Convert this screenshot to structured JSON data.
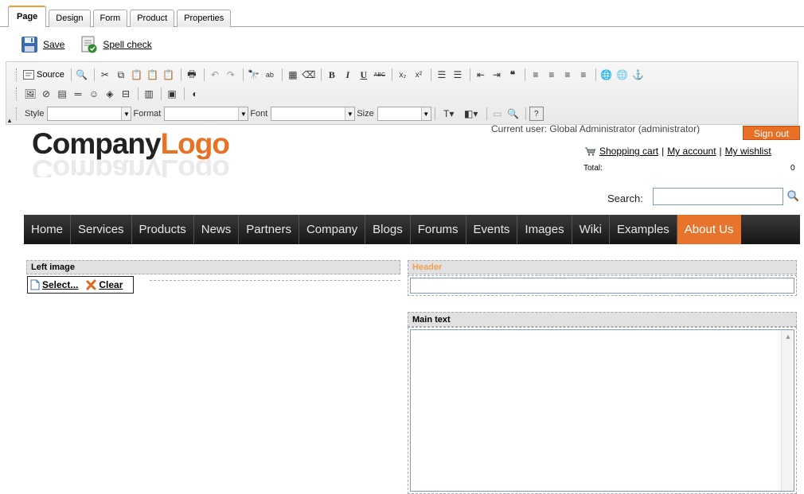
{
  "tabs": [
    "Page",
    "Design",
    "Form",
    "Product",
    "Properties"
  ],
  "actions": {
    "save": "Save",
    "spell": "Spell check"
  },
  "toolbar": {
    "source": "Source",
    "style_label": "Style",
    "format_label": "Format",
    "font_label": "Font",
    "size_label": "Size"
  },
  "logo": {
    "part1": "Company",
    "part2": "Logo"
  },
  "user": {
    "current": "Current user:  Global Administrator (administrator)",
    "signout": "Sign out"
  },
  "links": {
    "cart": "Shopping cart",
    "account": "My account",
    "wishlist": "My wishlist"
  },
  "total": {
    "label": "Total:",
    "value": "0"
  },
  "search": {
    "label": "Search:",
    "value": ""
  },
  "menu": [
    "Home",
    "Services",
    "Products",
    "News",
    "Partners",
    "Company",
    "Blogs",
    "Forums",
    "Events",
    "Images",
    "Wiki",
    "Examples",
    "About Us"
  ],
  "menu_active": "About Us",
  "editor": {
    "left_image": "Left image",
    "select": "Select...",
    "clear": "Clear",
    "header": "Header",
    "header_value": "",
    "main_text": "Main text"
  },
  "colors": {
    "accent": "#e8732a",
    "menu_bg": "#1c1c1c",
    "tab_active_border": "#f0a033"
  }
}
